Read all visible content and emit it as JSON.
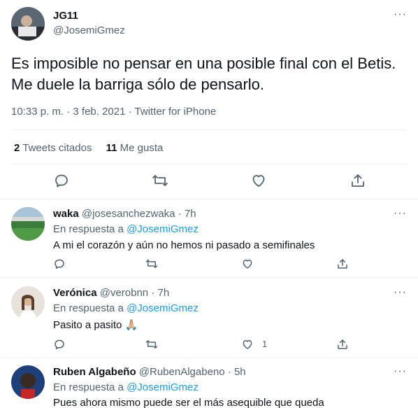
{
  "main_tweet": {
    "name": "JG11",
    "handle": "@JosemiGmez",
    "text_line1": "Es imposible no pensar en una posible final con el Betis.",
    "text_line2": "Me duele la barriga sólo de pensarlo.",
    "time": "10:33 p. m.",
    "dot": "·",
    "date": "3 feb. 2021",
    "source": "Twitter for iPhone",
    "quote_count": "2",
    "quote_label": "Tweets citados",
    "like_count": "11",
    "like_label": "Me gusta",
    "more": "···"
  },
  "replies": [
    {
      "name": "waka",
      "handle": "@josesanchezwaka",
      "dot": "·",
      "age": "7h",
      "in_reply_prefix": "En respuesta a",
      "in_reply_handle": "@JosemiGmez",
      "text": "A mi el corazón y aún no hemos ni pasado a semifinales",
      "more": "···",
      "like_count": ""
    },
    {
      "name": "Verónica",
      "handle": "@verobnn",
      "dot": "·",
      "age": "7h",
      "in_reply_prefix": "En respuesta a",
      "in_reply_handle": "@JosemiGmez",
      "text": "Pasito a pasito 🙏🏼",
      "more": "···",
      "like_count": "1"
    },
    {
      "name": "Ruben Algabeño",
      "handle": "@RubenAlgabeno",
      "dot": "·",
      "age": "5h",
      "in_reply_prefix": "En respuesta a",
      "in_reply_handle": "@JosemiGmez",
      "text": "Pues ahora mismo puede ser el más asequible que queda",
      "more": "···",
      "like_count": ""
    }
  ],
  "icons": [
    "reply-icon",
    "retweet-icon",
    "like-icon",
    "share-icon",
    "more-icon"
  ],
  "colors": {
    "accent": "#1d9bf0",
    "muted": "#536471",
    "text": "#0f1419",
    "divider": "#eff3f4"
  }
}
